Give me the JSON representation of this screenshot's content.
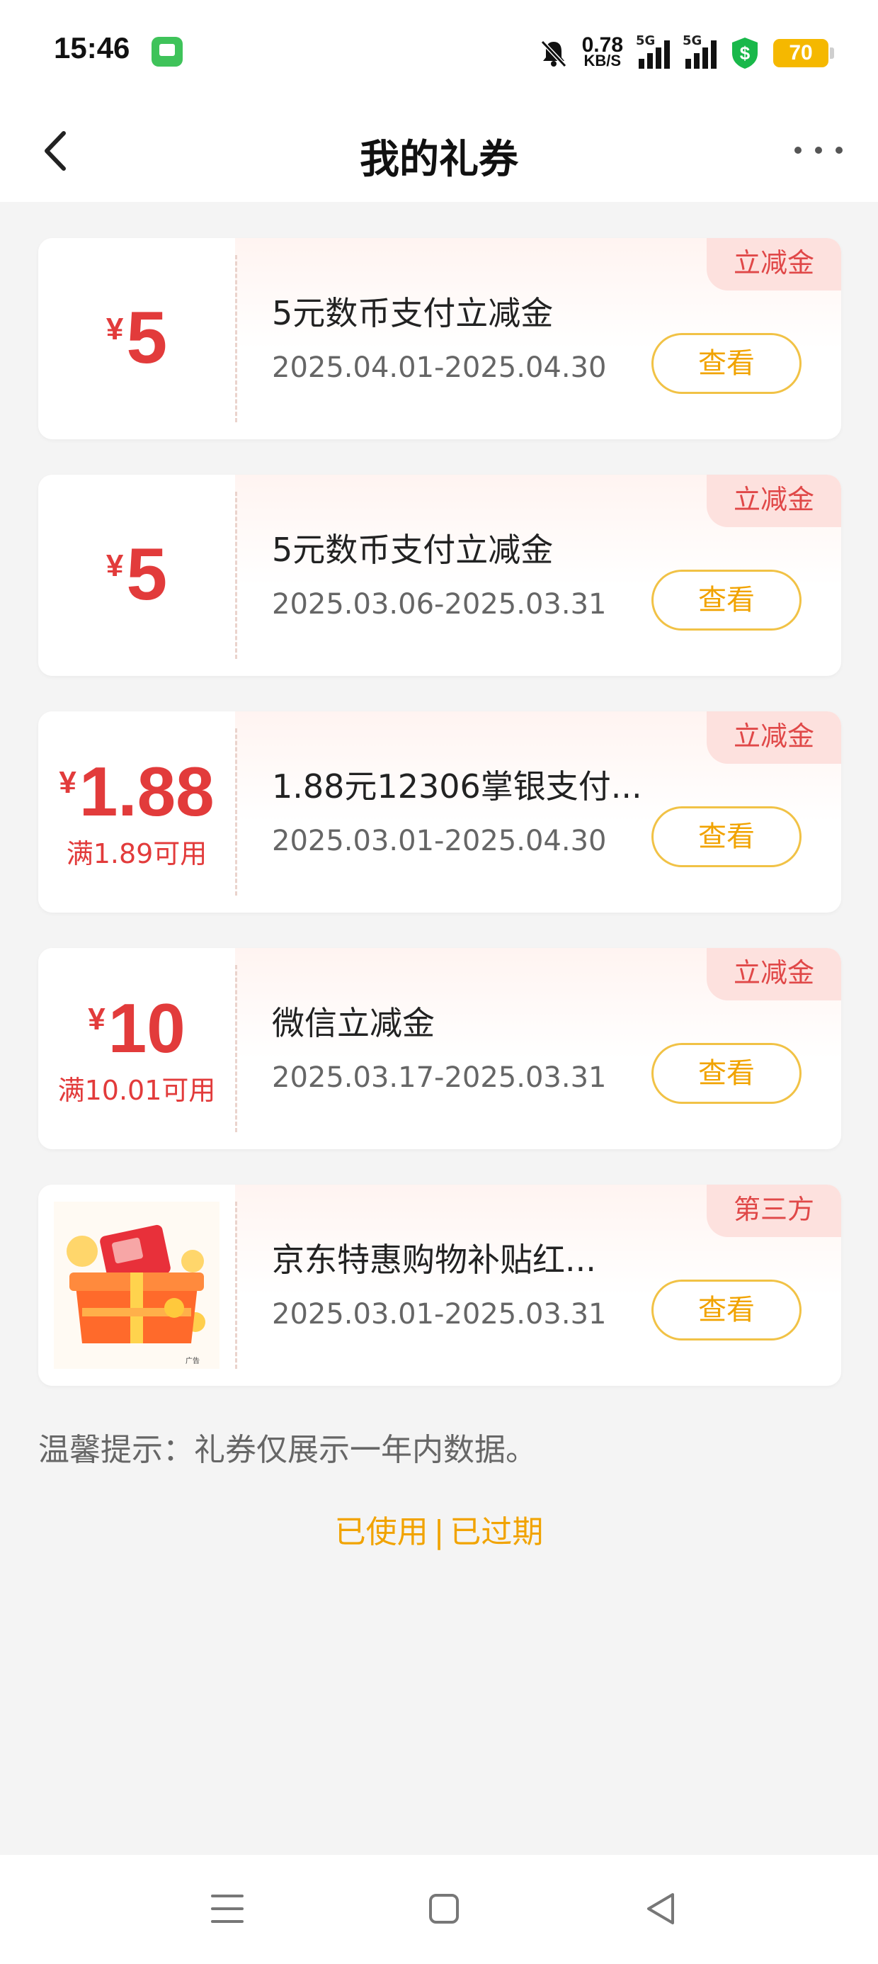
{
  "status_bar": {
    "time": "15:46",
    "net_speed": "0.78",
    "net_unit": "KB/S",
    "sim1_label": "5G",
    "sim2_label": "5G",
    "battery": "70"
  },
  "header": {
    "title": "我的礼券"
  },
  "coupons": [
    {
      "currency": "¥",
      "amount": "5",
      "condition": "",
      "name": "5元数币支付立减金",
      "date_range": "2025.04.01-2025.04.30",
      "button": "查看",
      "tag": "立减金"
    },
    {
      "currency": "¥",
      "amount": "5",
      "condition": "",
      "name": "5元数币支付立减金",
      "date_range": "2025.03.06-2025.03.31",
      "button": "查看",
      "tag": "立减金"
    },
    {
      "currency": "¥",
      "amount": "1.88",
      "condition": "满1.89可用",
      "name": "1.88元12306掌银支付...",
      "date_range": "2025.03.01-2025.04.30",
      "button": "查看",
      "tag": "立减金"
    },
    {
      "currency": "¥",
      "amount": "10",
      "condition": "满10.01可用",
      "name": "微信立减金",
      "date_range": "2025.03.17-2025.03.31",
      "button": "查看",
      "tag": "立减金"
    },
    {
      "currency": "",
      "amount": "",
      "condition": "",
      "name": "京东特惠购物补贴红...",
      "date_range": "2025.03.01-2025.03.31",
      "button": "查看",
      "tag": "第三方",
      "image_label": "广告"
    }
  ],
  "hint": "温馨提示：礼券仅展示一年内数据。",
  "footer_links": {
    "used": "已使用",
    "separator": "|",
    "expired": "已过期"
  },
  "colors": {
    "accent_red": "#e23b3b",
    "accent_orange": "#f1a300",
    "tag_bg": "#fde1de"
  },
  "icons": [
    "back-arrow-icon",
    "more-dots-icon",
    "mute-bell-icon",
    "signal-icon",
    "shield-dollar-icon",
    "battery-icon",
    "menu-icon",
    "home-square-icon",
    "back-triangle-icon"
  ]
}
